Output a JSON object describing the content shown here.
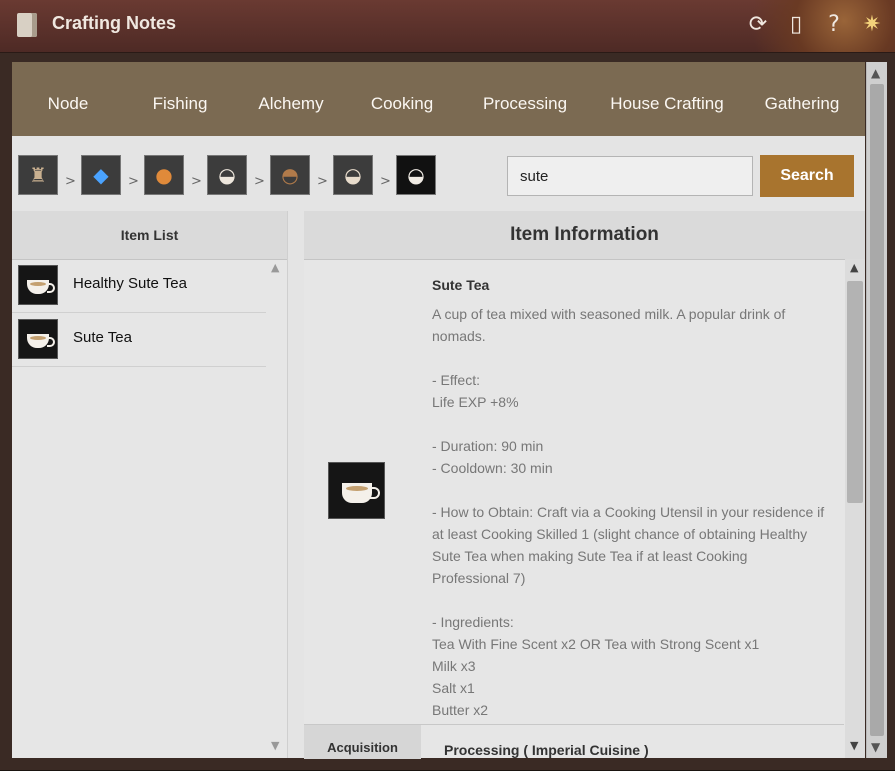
{
  "window": {
    "title": "Crafting Notes",
    "icons": [
      "refresh-icon",
      "document-icon",
      "help-icon",
      "compass-star-icon"
    ]
  },
  "tabs": [
    "Node",
    "Fishing",
    "Alchemy",
    "Cooking",
    "Processing",
    "House Crafting",
    "Gathering"
  ],
  "breadcrumb": {
    "separator": ">",
    "items": [
      "root-item-icon",
      "water-magic-icon",
      "tea-leaves-icon",
      "tea-plate-icon",
      "tea-bowl-icon",
      "tea-cup-icon",
      "sute-tea-icon"
    ]
  },
  "search": {
    "value": "sute",
    "button_label": "Search"
  },
  "item_list": {
    "header": "Item List",
    "items": [
      {
        "label": "Healthy Sute Tea"
      },
      {
        "label": "Sute Tea"
      }
    ]
  },
  "item_info": {
    "header": "Item Information",
    "name": "Sute Tea",
    "description": "A cup of tea mixed with seasoned milk. A popular drink of nomads.",
    "effect_header": "- Effect:",
    "effect_value": "Life EXP +8%",
    "duration": "- Duration: 90 min",
    "cooldown": "- Cooldown: 30 min",
    "how_to_obtain": "- How to Obtain: Craft via a Cooking Utensil in your residence if at least Cooking Skilled 1 (slight chance of obtaining Healthy Sute Tea when making Sute Tea if at least Cooking Professional 7)",
    "ingredients_header": "- Ingredients:",
    "ingredients": [
      "Tea With Fine Scent x2 OR Tea with Strong Scent x1",
      "Milk x3",
      "Salt x1",
      "Butter x2"
    ],
    "acquisition_label": "Acquisition",
    "acquisition_value": "Processing ( Imperial Cuisine )"
  },
  "colors": {
    "titlebar": "#5a322c",
    "tabbar": "#7b6a52",
    "search_button": "#a8742e",
    "panel": "#e6e6e6"
  }
}
